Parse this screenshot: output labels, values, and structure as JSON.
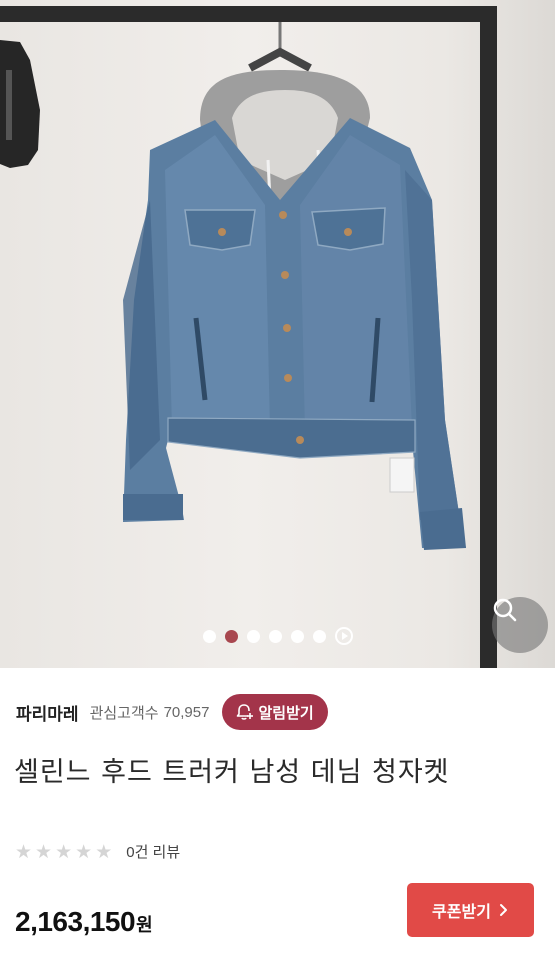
{
  "image_gallery": {
    "dot_count": 6,
    "active_index": 1,
    "has_video_indicator": true,
    "active_color": "#a8474f",
    "zoom_icon": "search-icon"
  },
  "product": {
    "store_name": "파리마레",
    "watch_label": "관심고객수",
    "watch_count": "70,957",
    "alarm_label": "알림받기",
    "alarm_icon": "bell-plus-icon",
    "title": "셀린느 후드 트러커 남성 데님 청자켓",
    "rating_stars": 5,
    "rating_value": 0,
    "review_text": "0건 리뷰",
    "price": "2,163,150",
    "price_unit": "원",
    "coupon_label": "쿠폰받기",
    "coupon_icon": "chevron-right-icon"
  },
  "colors": {
    "alarm_button": "#a3344a",
    "coupon_button": "#e14a47",
    "star_empty": "#d5d5d5"
  }
}
